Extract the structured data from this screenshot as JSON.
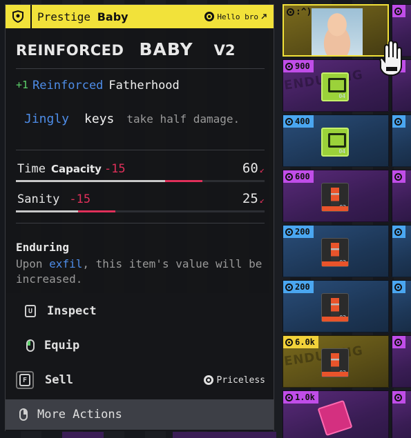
{
  "header": {
    "prefix": "Prestige",
    "title": "Baby",
    "owner": "Hello bro",
    "owner_icon": "external-link-icon"
  },
  "item": {
    "name_part1": "REINFORCED",
    "name_part2": "BABY",
    "version": "V2"
  },
  "trait": {
    "amount": "+1",
    "qualifier": "Reinforced",
    "name": "Fatherhood"
  },
  "effect": {
    "word1": "Jingly",
    "word2": "keys",
    "rest": "take half damage."
  },
  "stats": [
    {
      "label": "Time",
      "label2": "Capacity",
      "delta": "-15",
      "value": "60",
      "fraction": 0.6,
      "loss_fraction": 0.15
    },
    {
      "label": "Sanity",
      "label2": "",
      "delta": "-15",
      "value": "25",
      "fraction": 0.25,
      "loss_fraction": 0.15
    }
  ],
  "perk": {
    "title": "Enduring",
    "desc_before": "Upon",
    "highlight": "exfil",
    "desc_after": ", this item's value will be increased."
  },
  "actions": [
    {
      "key": "U",
      "label": "Inspect"
    },
    {
      "key": "mouse-left",
      "label": "Equip"
    },
    {
      "key": "F",
      "label": "Sell",
      "price": "Priceless"
    },
    {
      "key": "mouse-right",
      "label": "More Actions"
    }
  ],
  "grid": {
    "selected": {
      "badge": ":^)",
      "rarity": "gold"
    },
    "column": [
      {
        "price": "900",
        "rarity": "purple",
        "icon": "green-device",
        "tag": "04"
      },
      {
        "price": "400",
        "rarity": "blue",
        "icon": "green-device",
        "tag": "04"
      },
      {
        "price": "600",
        "rarity": "purple",
        "icon": "orange-robot",
        "tag": "02"
      },
      {
        "price": "200",
        "rarity": "blue",
        "icon": "orange-robot",
        "tag": "02"
      },
      {
        "price": "200",
        "rarity": "blue",
        "icon": "orange-robot",
        "tag": "02"
      },
      {
        "price": "6.0k",
        "rarity": "gold",
        "icon": "orange-robot",
        "tag": "03"
      },
      {
        "price": "1.0k",
        "rarity": "purple",
        "icon": "pink-chest",
        "tag": ""
      }
    ],
    "overlay_text": "ENDURING"
  },
  "colors": {
    "accent": "#f2e23a",
    "blue": "#4e8de8",
    "red": "#e0305a",
    "green": "#5ccf6a"
  }
}
